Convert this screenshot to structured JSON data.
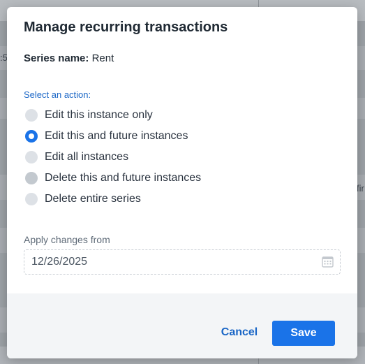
{
  "background": {
    "left_fragment": ":5",
    "right_fragment": "fir"
  },
  "dialog": {
    "title": "Manage recurring transactions",
    "series_label": "Series name:",
    "series_value": "Rent",
    "action_prompt": "Select an action:",
    "options": [
      {
        "label": "Edit this instance only",
        "selected": false
      },
      {
        "label": "Edit this and future instances",
        "selected": true
      },
      {
        "label": "Edit all instances",
        "selected": false
      },
      {
        "label": "Delete this and future instances",
        "selected": false,
        "hovered": true
      },
      {
        "label": "Delete entire series",
        "selected": false
      }
    ],
    "date_label": "Apply changes from",
    "date_value": "12/26/2025",
    "date_icon": "calendar-icon",
    "cancel_label": "Cancel",
    "save_label": "Save"
  },
  "colors": {
    "accent": "#1a73e8",
    "link": "#1a66c6",
    "radio_unselected": "#dde1e6"
  }
}
